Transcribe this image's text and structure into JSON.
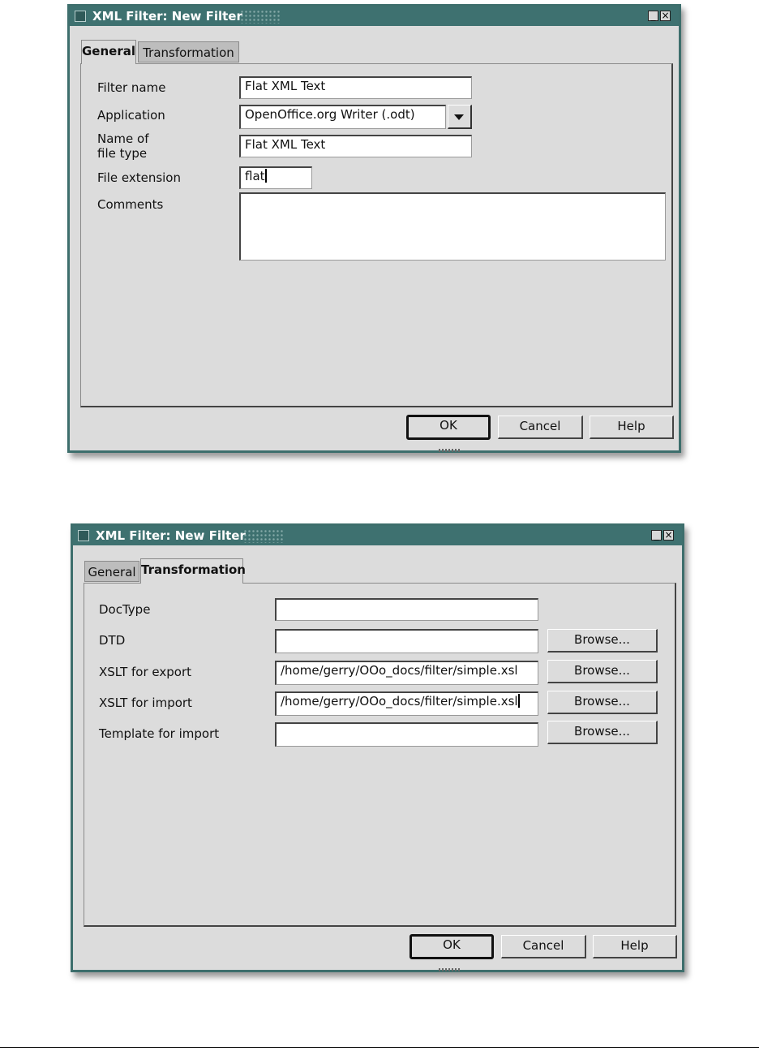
{
  "dialog_general": {
    "title": "XML Filter: New Filter",
    "tabs": [
      "General",
      "Transformation"
    ],
    "fields": {
      "filter_name": {
        "label": "Filter name",
        "value": "Flat XML Text"
      },
      "application": {
        "label": "Application",
        "value": "OpenOffice.org Writer (.odt)"
      },
      "name_of_file_type": {
        "label_line1": "Name of",
        "label_line2": "file type",
        "value": "Flat XML Text"
      },
      "file_extension": {
        "label": "File extension",
        "value": "flat"
      },
      "comments": {
        "label": "Comments",
        "value": ""
      }
    },
    "buttons": {
      "ok": "OK",
      "cancel": "Cancel",
      "help": "Help"
    }
  },
  "dialog_transformation": {
    "title": "XML Filter: New Filter",
    "tabs": [
      "General",
      "Transformation"
    ],
    "fields": {
      "doctype": {
        "label": "DocType",
        "value": ""
      },
      "dtd": {
        "label": "DTD",
        "value": ""
      },
      "xslt_export": {
        "label": "XSLT for export",
        "value": "/home/gerry/OOo_docs/filter/simple.xsl"
      },
      "xslt_import": {
        "label": "XSLT for import",
        "value": "/home/gerry/OOo_docs/filter/simple.xsl"
      },
      "template_import": {
        "label": "Template for import",
        "value": ""
      }
    },
    "browse_label": "Browse...",
    "buttons": {
      "ok": "OK",
      "cancel": "Cancel",
      "help": "Help"
    }
  },
  "icons": {
    "window_system": "window-menu-icon",
    "minimize": "minimize-icon",
    "close": "close-icon",
    "dropdown": "chevron-down-icon"
  },
  "colors": {
    "titlebar": "#3e7170",
    "dialog_bg": "#dcdcdc",
    "field_bg": "#ffffff"
  }
}
